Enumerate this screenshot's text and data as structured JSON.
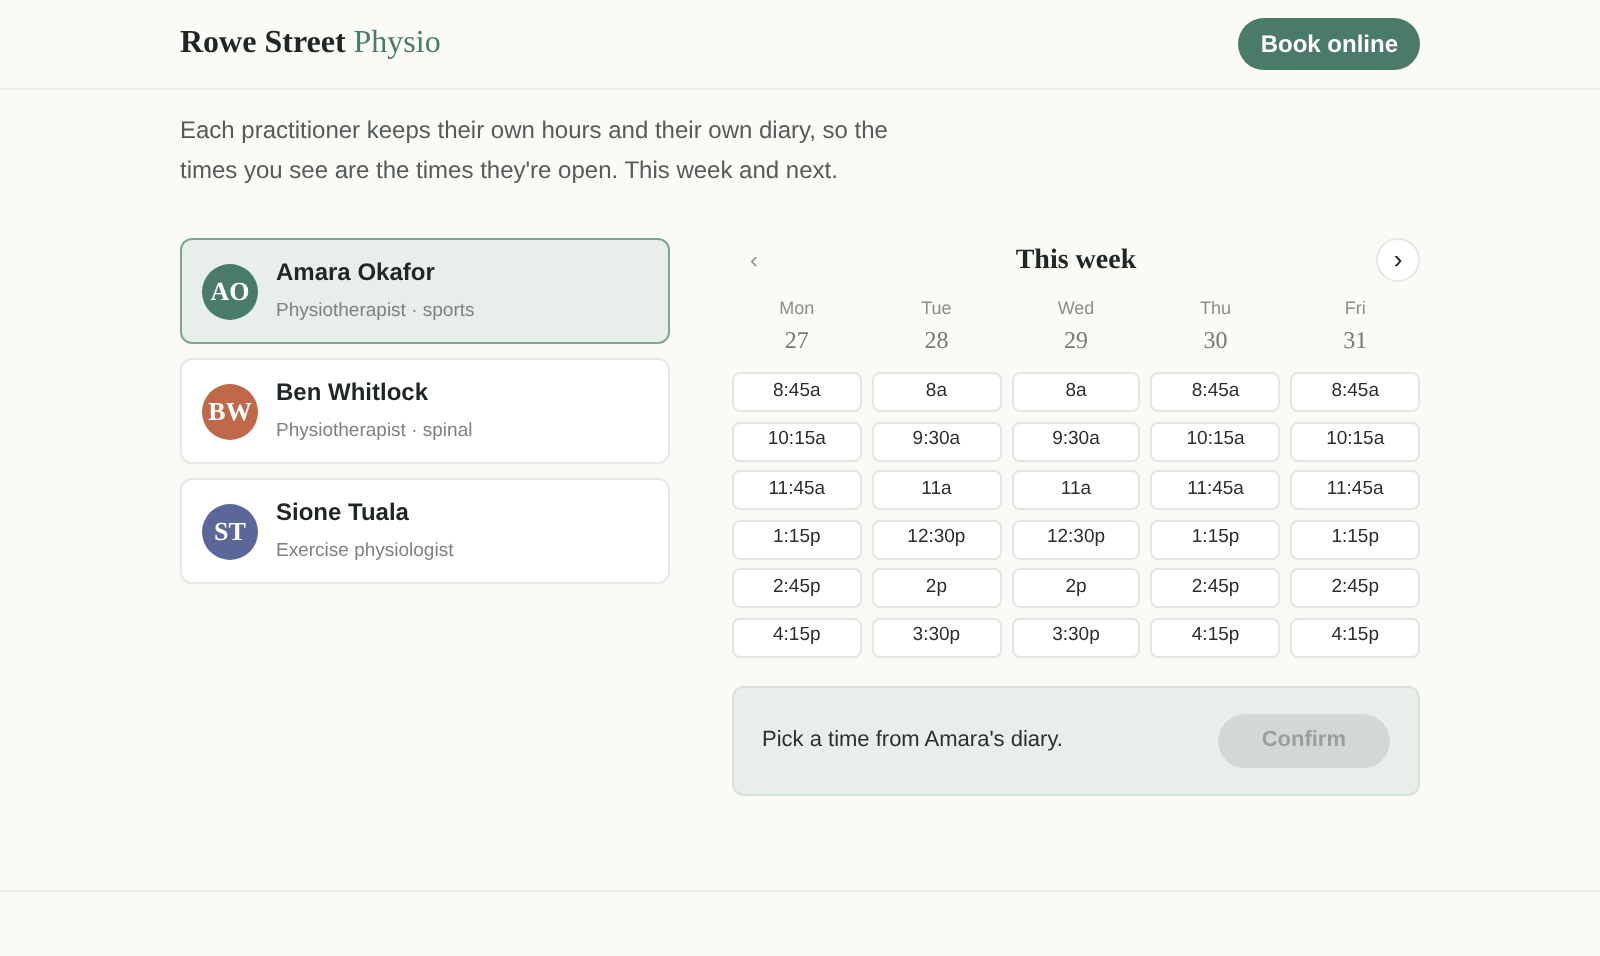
{
  "brand": {
    "name": "Rowe Street",
    "accent": "Physio"
  },
  "header_button": "Book online",
  "intro": "Each practitioner keeps their own hours and their own diary, so the times you see are the times they're open. This week and next.",
  "practitioners": [
    {
      "initials": "AO",
      "name": "Amara Okafor",
      "role": "Physiotherapist · sports",
      "color": "#4a7a68",
      "selected": true
    },
    {
      "initials": "BW",
      "name": "Ben Whitlock",
      "role": "Physiotherapist · spinal",
      "color": "#c0684a",
      "selected": false
    },
    {
      "initials": "ST",
      "name": "Sione Tuala",
      "role": "Exercise physiologist",
      "color": "#5b6699",
      "selected": false
    }
  ],
  "calendar": {
    "title": "This week",
    "prev": {
      "symbol": "‹",
      "disabled": true
    },
    "next": {
      "symbol": "›",
      "disabled": false
    },
    "days": [
      {
        "weekday": "Mon",
        "date": "27",
        "slots": [
          "8:45a",
          "10:15a",
          "11:45a",
          "1:15p",
          "2:45p",
          "4:15p"
        ]
      },
      {
        "weekday": "Tue",
        "date": "28",
        "slots": [
          "8a",
          "9:30a",
          "11a",
          "12:30p",
          "2p",
          "3:30p"
        ]
      },
      {
        "weekday": "Wed",
        "date": "29",
        "slots": [
          "8a",
          "9:30a",
          "11a",
          "12:30p",
          "2p",
          "3:30p"
        ]
      },
      {
        "weekday": "Thu",
        "date": "30",
        "slots": [
          "8:45a",
          "10:15a",
          "11:45a",
          "1:15p",
          "2:45p",
          "4:15p"
        ]
      },
      {
        "weekday": "Fri",
        "date": "31",
        "slots": [
          "8:45a",
          "10:15a",
          "11:45a",
          "1:15p",
          "2:45p",
          "4:15p"
        ]
      }
    ]
  },
  "confirm_bar": {
    "message": "Pick a time from Amara's diary.",
    "button": {
      "label": "Confirm",
      "disabled": true
    }
  }
}
